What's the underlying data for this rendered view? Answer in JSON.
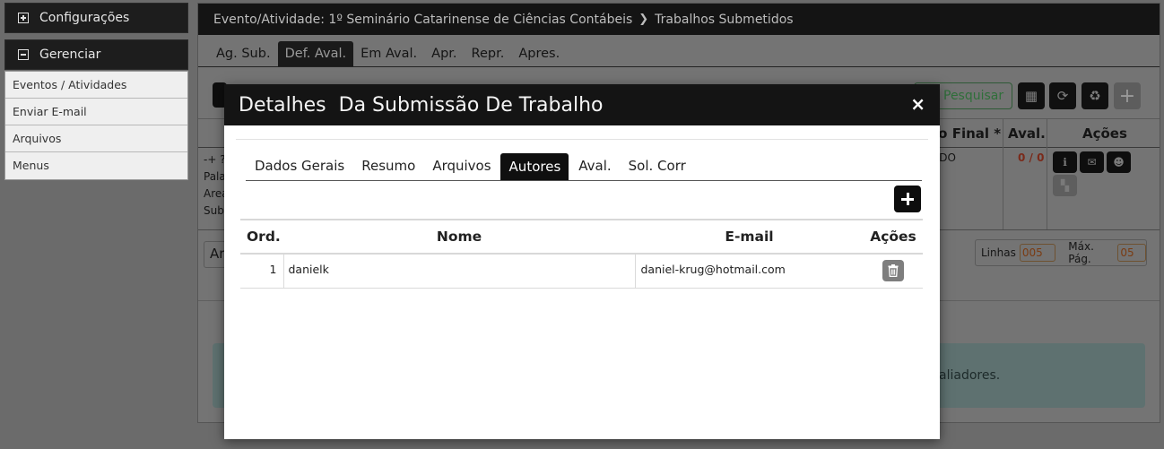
{
  "sidebar": {
    "config_label": "Configurações",
    "manage_label": "Gerenciar",
    "items": [
      {
        "label": "Eventos / Atividades"
      },
      {
        "label": "Enviar E-mail"
      },
      {
        "label": "Arquivos"
      },
      {
        "label": "Menus"
      }
    ]
  },
  "breadcrumb": {
    "event": "Evento/Atividade: 1º Seminário Catarinense de Ciências Contábeis",
    "separator": "❯",
    "page": "Trabalhos Submetidos"
  },
  "tabs": [
    {
      "label": "Ag. Sub."
    },
    {
      "label": "Def. Aval.",
      "active": true
    },
    {
      "label": "Em Aval."
    },
    {
      "label": "Apr."
    },
    {
      "label": "Repr."
    },
    {
      "label": "Apres."
    }
  ],
  "toolbar": {
    "search_label": "Pesquisar"
  },
  "background_table": {
    "headers": {
      "final": "to Final *",
      "aval": "Aval.",
      "acoes": "Ações"
    },
    "row": {
      "lines": [
        "-+ ?",
        "Pala",
        "Area",
        "Sub"
      ],
      "status": "ADO",
      "aval": "0 / 0"
    }
  },
  "pagination": {
    "ar_label": "Ar",
    "lines_label": "Linhas",
    "lines_value": "005",
    "max_label": "Máx. Pág.",
    "max_value": "05"
  },
  "alert": {
    "text": "aliadores."
  },
  "modal": {
    "title": "Detalhes  Da Submissão De Trabalho",
    "close": "×",
    "tabs": [
      {
        "label": "Dados Gerais"
      },
      {
        "label": "Resumo"
      },
      {
        "label": "Arquivos"
      },
      {
        "label": "Autores",
        "active": true
      },
      {
        "label": "Aval."
      },
      {
        "label": "Sol. Corr"
      }
    ],
    "table": {
      "headers": {
        "ord": "Ord.",
        "nome": "Nome",
        "email": "E-mail",
        "acoes": "Ações"
      },
      "rows": [
        {
          "ord": "1",
          "nome": "danielk",
          "email": "daniel-krug@hotmail.com"
        }
      ]
    }
  },
  "colors": {
    "header_bg": "#141414",
    "active_tab_bg": "#0f0f0f",
    "overlay_bg": "#6b6b6b",
    "alert_bg": "#5e7170",
    "search_green": "#2f6f3a"
  }
}
